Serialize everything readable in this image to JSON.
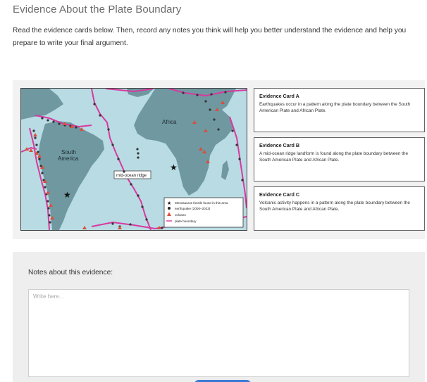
{
  "page": {
    "title": "Evidence About the Plate Boundary",
    "intro": "Read the evidence cards below. Then, record any notes you think will help you better understand the evidence and help you prepare to write your final argument."
  },
  "map": {
    "labels": {
      "africa": "Africa",
      "south_america": [
        "South",
        "America"
      ],
      "ridge_callout": "mid-ocean ridge"
    },
    "legend": [
      {
        "symbol": "star-icon",
        "text": "Mesosaurus fossils found in this area"
      },
      {
        "symbol": "dot-icon",
        "text": "earthquake (2000–2022)"
      },
      {
        "symbol": "triangle-icon",
        "text": "volcano"
      },
      {
        "symbol": "line-icon",
        "text": "plate boundary"
      }
    ],
    "colors": {
      "ocean": "#b9dbe3",
      "land": "#6f98a0",
      "boundary": "#d63aa0",
      "volcano": "#d94f3d",
      "earthquake": "#333333"
    }
  },
  "cards": [
    {
      "title": "Evidence Card A",
      "text": "Earthquakes occur in a pattern along the plate boundary between the South American Plate and African Plate."
    },
    {
      "title": "Evidence Card B",
      "text": "A mid-ocean ridge landform is found along the plate boundary between the South American Plate and African Plate."
    },
    {
      "title": "Evidence Card C",
      "text": "Volcanic activity happens in a pattern along the plate boundary between the South American Plate and African Plate."
    }
  ],
  "notes": {
    "label": "Notes about this evidence:",
    "placeholder": "Write here...",
    "value": ""
  }
}
